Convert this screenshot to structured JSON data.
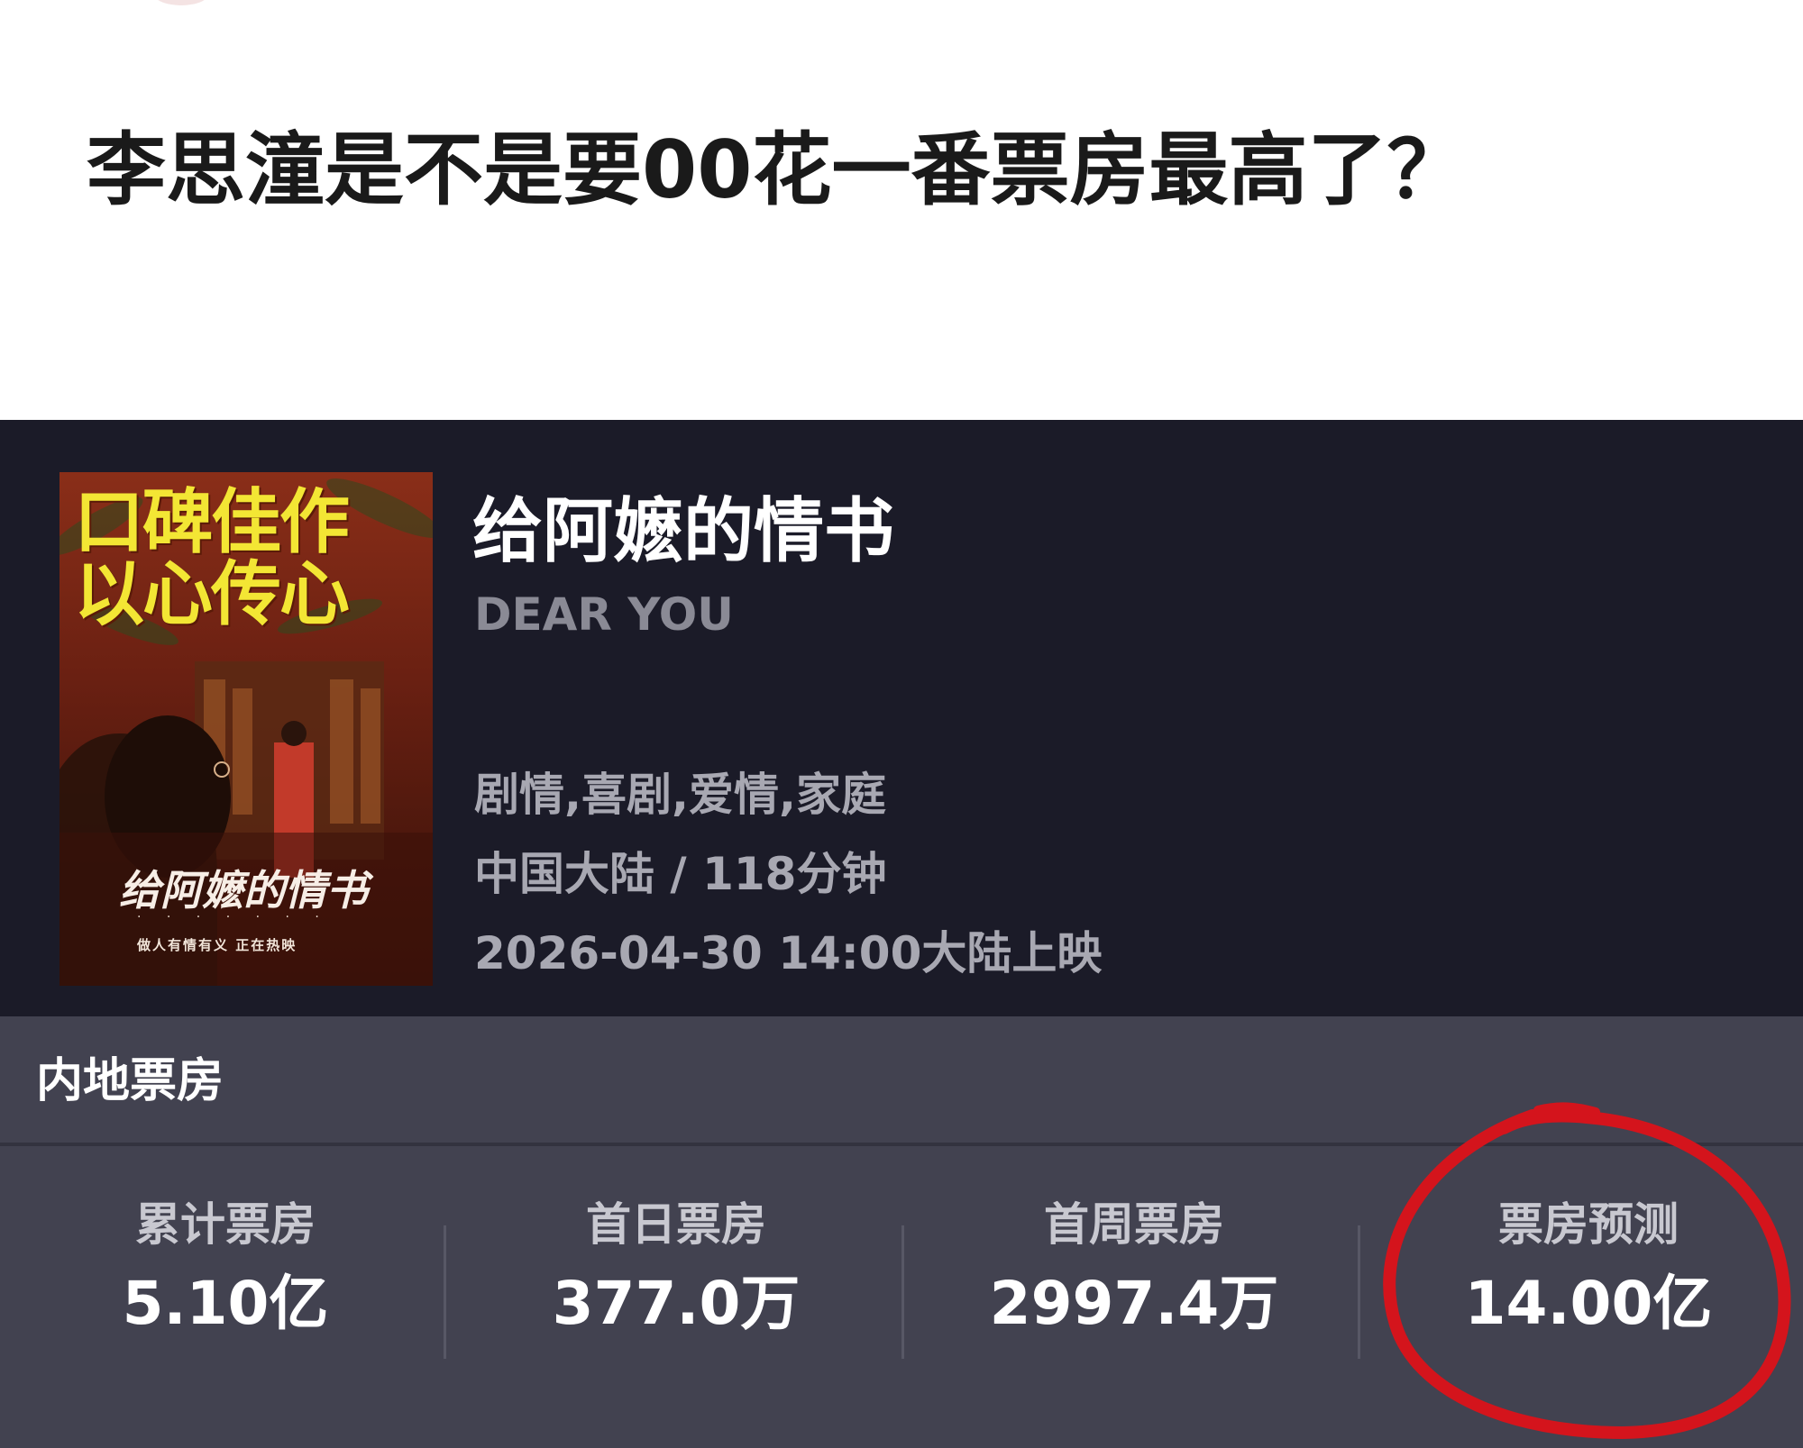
{
  "post": {
    "title": "李思潼是不是要00花一番票房最高了？"
  },
  "movie": {
    "poster": {
      "slogan_line1": "口碑佳作",
      "slogan_line2": "以心传心",
      "title_calligraphy": "给阿嬷的情书",
      "tagline": "做人有情有义  正在热映"
    },
    "title": "给阿嬷的情书",
    "english_title": "DEAR YOU",
    "genres": "剧情,喜剧,爱情,家庭",
    "region_duration": "中国大陆 / 118分钟",
    "release": "2026-04-30 14:00大陆上映"
  },
  "box_office": {
    "section_title": "内地票房",
    "stats": [
      {
        "label": "累计票房",
        "value": "5.10亿"
      },
      {
        "label": "首日票房",
        "value": "377.0万"
      },
      {
        "label": "首周票房",
        "value": "2997.4万"
      },
      {
        "label": "票房预测",
        "value": "14.00亿"
      }
    ]
  },
  "colors": {
    "header_bg": "#1b1b28",
    "section_bg": "#424250",
    "annotation_red": "#d4141c",
    "slogan_yellow": "#f3e634"
  }
}
